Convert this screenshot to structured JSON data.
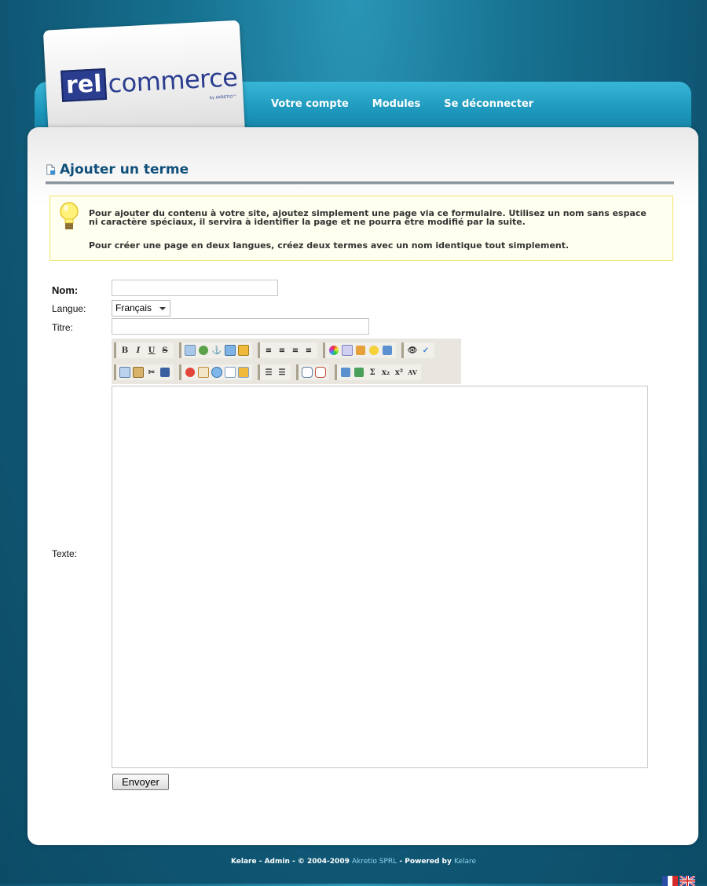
{
  "header": {
    "logo_rel": "rel",
    "logo_commerce": "commerce",
    "logo_by": "by AKRETIO™",
    "nav": [
      "Votre compte",
      "Modules",
      "Se déconnecter"
    ]
  },
  "page": {
    "title": "Ajouter un terme"
  },
  "info": {
    "line1": "Pour ajouter du contenu à votre site, ajoutez simplement une page via ce formulaire. Utilisez un nom sans espace ni caractère spéciaux, il servira à identifier la page et ne pourra être modifié par la suite.",
    "line2": "Pour créer une page en deux langues, créez deux termes avec un nom identique tout simplement."
  },
  "form": {
    "nom_label": "Nom:",
    "nom_value": "",
    "langue_label": "Langue:",
    "langue_selected": "Français",
    "titre_label": "Titre:",
    "titre_value": "",
    "texte_label": "Texte:",
    "submit_label": "Envoyer"
  },
  "toolbar": {
    "bold": "B",
    "italic": "I",
    "underline": "U",
    "strike": "S",
    "sum": "Σ",
    "subscript": "x₂",
    "superscript": "x²",
    "av": "AV"
  },
  "footer": {
    "part1": "Kelare - Admin",
    "sep1": " - ",
    "copyright": "© 2004-2009 ",
    "company": "Akretio SPRL",
    "sep2": " - ",
    "powered": "Powered by ",
    "powered_link": "Kelare"
  },
  "colors": {
    "accent": "#0f4f7a",
    "nav_bar": "#1a93b8",
    "background": "#0f5673"
  }
}
